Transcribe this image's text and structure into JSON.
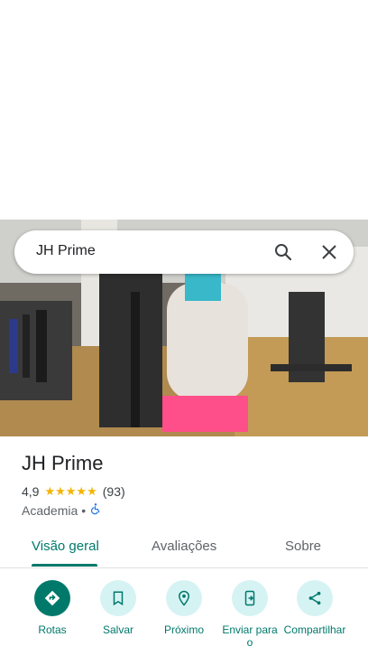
{
  "search": {
    "query": "JH Prime"
  },
  "place": {
    "name": "JH Prime",
    "rating": "4,9",
    "stars": "★★★★★",
    "reviews": "(93)",
    "category": "Academia",
    "separator": "•"
  },
  "tabs": [
    {
      "label": "Visão geral",
      "active": true
    },
    {
      "label": "Avaliações",
      "active": false
    },
    {
      "label": "Sobre",
      "active": false
    }
  ],
  "actions": [
    {
      "label": "Rotas",
      "icon": "directions-icon"
    },
    {
      "label": "Salvar",
      "icon": "bookmark-icon"
    },
    {
      "label": "Próximo",
      "icon": "nearby-icon"
    },
    {
      "label": "Enviar para o",
      "icon": "send-to-phone-icon"
    },
    {
      "label": "Compartilhar",
      "icon": "share-icon"
    }
  ],
  "colors": {
    "accent": "#00796b",
    "chip": "#d6f3f4",
    "star": "#f4b400"
  }
}
